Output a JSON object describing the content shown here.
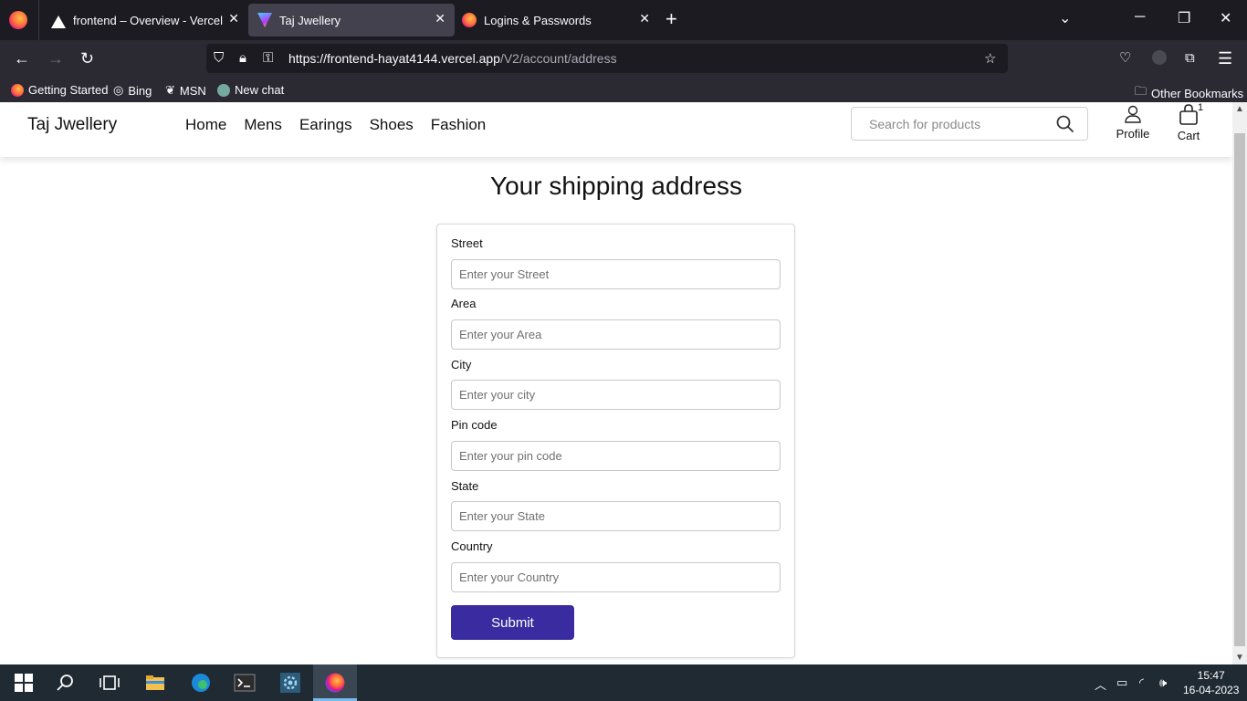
{
  "browser": {
    "tabs": [
      {
        "title": "frontend – Overview - Vercel",
        "icon": "vercel-icon"
      },
      {
        "title": "Taj Jwellery",
        "icon": "vite-icon"
      },
      {
        "title": "Logins & Passwords",
        "icon": "firefox-icon"
      }
    ],
    "url_host": "https://frontend-hayat4144.vercel.app",
    "url_path": "/V2/account/address",
    "bookmarks": [
      "Getting Started",
      "Bing",
      "MSN",
      "New chat"
    ],
    "other_bookmarks": "Other Bookmarks"
  },
  "site": {
    "brand": "Taj Jwellery",
    "nav": [
      "Home",
      "Mens",
      "Earings",
      "Shoes",
      "Fashion"
    ],
    "search_placeholder": "Search for products",
    "profile_label": "Profile",
    "cart_label": "Cart",
    "cart_count": "1"
  },
  "form": {
    "title": "Your shipping address",
    "fields": [
      {
        "label": "Street",
        "placeholder": "Enter your Street"
      },
      {
        "label": "Area",
        "placeholder": "Enter your Area"
      },
      {
        "label": "City",
        "placeholder": "Enter your city"
      },
      {
        "label": "Pin code",
        "placeholder": "Enter your pin code"
      },
      {
        "label": "State",
        "placeholder": "Enter your State"
      },
      {
        "label": "Country",
        "placeholder": "Enter your Country"
      }
    ],
    "submit_label": "Submit",
    "accent_color": "#3a2ba0"
  },
  "taskbar": {
    "time": "15:47",
    "date": "16-04-2023"
  }
}
